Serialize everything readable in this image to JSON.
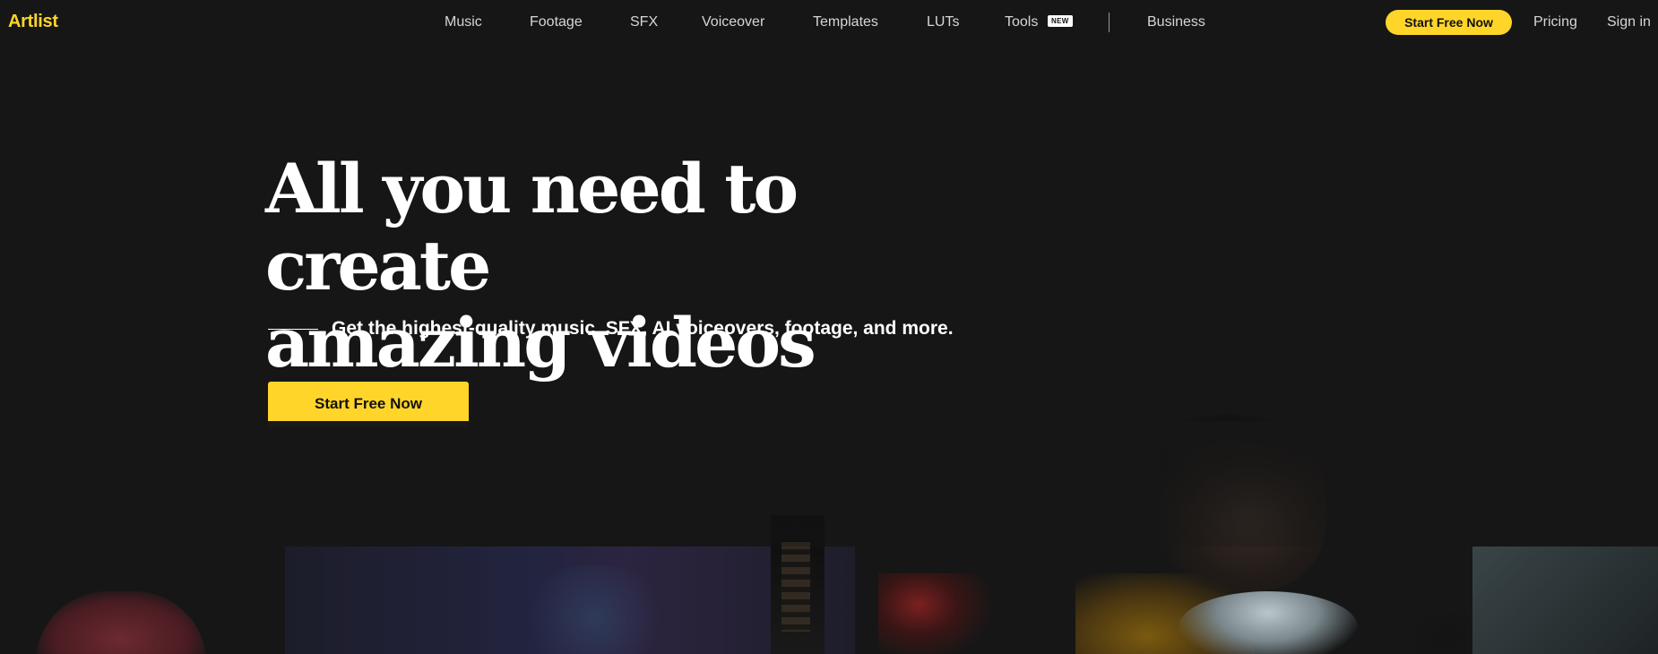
{
  "nav": {
    "logo": "Artlist",
    "links": {
      "music": "Music",
      "footage": "Footage",
      "sfx": "SFX",
      "voiceover": "Voiceover",
      "templates": "Templates",
      "luts": "LUTs",
      "tools": "Tools",
      "business": "Business",
      "pricing": "Pricing",
      "signin": "Sign in"
    },
    "tools_badge": "NEW",
    "cta": "Start Free Now"
  },
  "hero": {
    "title_line1": "All you need to create",
    "title_line2": "amazing videos",
    "subtitle": "Get the highest-quality music, SFX, AI voiceovers, footage, and more.",
    "cta": "Start Free Now"
  },
  "colors": {
    "background": "#161616",
    "accent": "#ffd52a",
    "text": "#ffffff",
    "nav_text": "#d6d6d6"
  }
}
